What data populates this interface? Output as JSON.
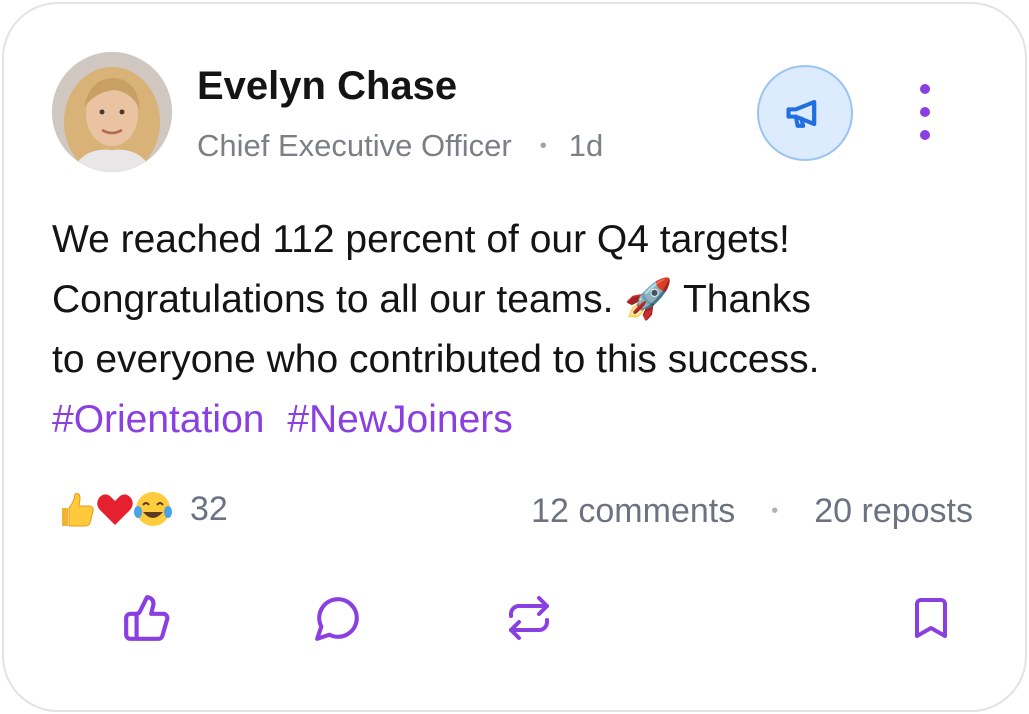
{
  "post": {
    "author": {
      "name": "Evelyn Chase",
      "title": "Chief Executive Officer",
      "time": "1d"
    },
    "body": {
      "lines": [
        "We reached 112 percent of our Q4 targets!",
        "Congratulations to all our teams. 🚀 Thanks",
        "to everyone who contributed to this success."
      ],
      "hashtags": [
        "#Orientation",
        "#NewJoiners"
      ]
    },
    "reactions": {
      "icons": [
        "thumbs-up-emoji",
        "red-heart-emoji",
        "tears-of-joy-emoji"
      ],
      "count": "32"
    },
    "stats": {
      "comments": "12 comments",
      "reposts": "20 reposts"
    },
    "actions": [
      "like-icon",
      "comment-icon",
      "repost-icon",
      "bookmark-icon"
    ],
    "colors": {
      "accent": "#8a3fe0",
      "announce_bg": "#dcebfd",
      "announce_icon": "#1f6fe0",
      "muted_text": "#6d7280"
    }
  }
}
